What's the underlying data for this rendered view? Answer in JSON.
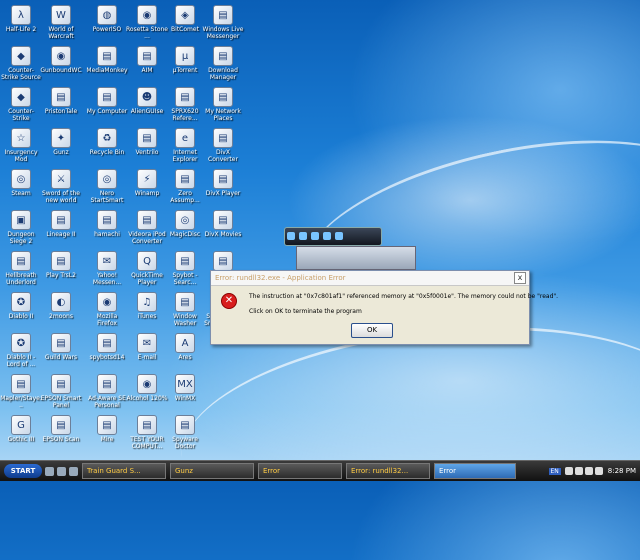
{
  "desktop_icons": [
    {
      "label": "Half-Life 2",
      "glyph": "λ"
    },
    {
      "label": "Counter-Strike Source",
      "glyph": "◆"
    },
    {
      "label": "Counter-Strike",
      "glyph": "◆"
    },
    {
      "label": "Insurgency Mod",
      "glyph": "☆"
    },
    {
      "label": "Steam",
      "glyph": "◎"
    },
    {
      "label": "Dungeon Siege 2",
      "glyph": "▣"
    },
    {
      "label": "Hellbreath Underlord",
      "glyph": "▤"
    },
    {
      "label": "Diablo II",
      "glyph": "✪"
    },
    {
      "label": "Diablo II - Lord of ...",
      "glyph": "✪"
    },
    {
      "label": "Mapler/Staye...",
      "glyph": "▤"
    },
    {
      "label": "Gothic III",
      "glyph": "G"
    },
    {
      "label": "World of Warcraft",
      "glyph": "W"
    },
    {
      "label": "GunboundWC",
      "glyph": "◉"
    },
    {
      "label": "PristonTale",
      "glyph": "▤"
    },
    {
      "label": "Gunz",
      "glyph": "✦"
    },
    {
      "label": "Sword of the new world",
      "glyph": "⚔"
    },
    {
      "label": "Lineage II",
      "glyph": "▤"
    },
    {
      "label": "Play TrsL2",
      "glyph": "▤"
    },
    {
      "label": "2moons",
      "glyph": "◐"
    },
    {
      "label": "Guild Wars",
      "glyph": "▤"
    },
    {
      "label": "EPSON Smart Panel",
      "glyph": "▤"
    },
    {
      "label": "EPSON Scan",
      "glyph": "▤"
    },
    {
      "label": "PowerISO",
      "glyph": "◍"
    },
    {
      "label": "MediaMonkey",
      "glyph": "▤"
    },
    {
      "label": "My Computer",
      "glyph": "▤"
    },
    {
      "label": "Recycle Bin",
      "glyph": "♻"
    },
    {
      "label": "Nero StartSmart",
      "glyph": "◎"
    },
    {
      "label": "hamachi",
      "glyph": "▤"
    },
    {
      "label": "Yahoo! Messen...",
      "glyph": "✉"
    },
    {
      "label": "Mozilla Firefox",
      "glyph": "◉"
    },
    {
      "label": "spybotsd14",
      "glyph": "▤"
    },
    {
      "label": "Ad-Aware SE Personal",
      "glyph": "▤"
    },
    {
      "label": "Mire",
      "glyph": "▤"
    },
    {
      "label": "Rosetta Stone ...",
      "glyph": "◉"
    },
    {
      "label": "AIM",
      "glyph": "▤"
    },
    {
      "label": "AlienGUIse",
      "glyph": "☻"
    },
    {
      "label": "Ventrilo",
      "glyph": "▤"
    },
    {
      "label": "Winamp",
      "glyph": "⚡"
    },
    {
      "label": "Videora iPod Converter",
      "glyph": "▤"
    },
    {
      "label": "QuickTime Player",
      "glyph": "Q"
    },
    {
      "label": "iTunes",
      "glyph": "♫"
    },
    {
      "label": "E-mail",
      "glyph": "✉"
    },
    {
      "label": "Alcohol 120%",
      "glyph": "◉"
    },
    {
      "label": "TEST YOUR COMPUT...",
      "glyph": "▤"
    },
    {
      "label": "BitComet",
      "glyph": "◈"
    },
    {
      "label": "µTorrent",
      "glyph": "µ"
    },
    {
      "label": "SPRX620 Refere...",
      "glyph": "▤"
    },
    {
      "label": "Internet Explorer",
      "glyph": "e"
    },
    {
      "label": "Zero Assump...",
      "glyph": "▤"
    },
    {
      "label": "MagicDisc",
      "glyph": "◎"
    },
    {
      "label": "Spybot - Searc...",
      "glyph": "▤"
    },
    {
      "label": "Window Washer",
      "glyph": "▤"
    },
    {
      "label": "Ares",
      "glyph": "A"
    },
    {
      "label": "WinMX",
      "glyph": "MX"
    },
    {
      "label": "Spyware Doctor",
      "glyph": "▤"
    },
    {
      "label": "Windows Live Messenger",
      "glyph": "▤"
    },
    {
      "label": "Download Manager",
      "glyph": "▤"
    },
    {
      "label": "My Network Places",
      "glyph": "▤"
    },
    {
      "label": "DivX Converter",
      "glyph": "▤"
    },
    {
      "label": "DivX Player",
      "glyph": "▤"
    },
    {
      "label": "DivX Movies",
      "glyph": "▤"
    },
    {
      "label": "Sp...",
      "glyph": "▤"
    },
    {
      "label": "Shortcut to SmitfraudFix",
      "glyph": "▤"
    }
  ],
  "dialog": {
    "title": "Error: rundll32.exe - Application Error",
    "close_label": "x",
    "message": "The instruction at \"0x7c801af1\" referenced memory at \"0x5f0001e\". The memory could not be \"read\".",
    "instruction": "Click on OK to terminate the program",
    "ok_label": "OK",
    "icon": "error-icon"
  },
  "taskbar": {
    "start_label": "START",
    "tasks": [
      {
        "label": "Train Guard S...",
        "active": false
      },
      {
        "label": "Gunz",
        "active": false
      },
      {
        "label": "Error",
        "active": false
      },
      {
        "label": "Error: rundll32...",
        "active": false
      },
      {
        "label": "Error",
        "active": true
      }
    ],
    "language": "EN",
    "clock": "8:28 PM"
  },
  "colors": {
    "desktop": "#1c7fd6",
    "dialog_bg": "#ece9d8",
    "error_red": "#d81e1e",
    "taskbar": "#1e1e1e"
  }
}
